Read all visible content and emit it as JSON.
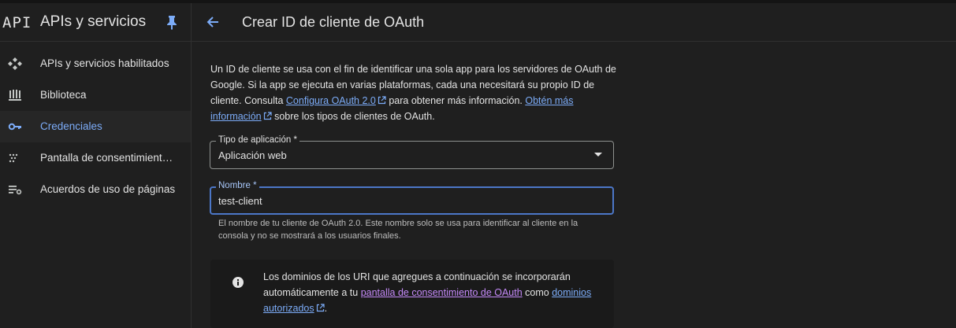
{
  "sidebar": {
    "logo": "API",
    "title": "APIs y servicios",
    "items": [
      {
        "label": "APIs y servicios habilitados",
        "icon": "api-services-icon"
      },
      {
        "label": "Biblioteca",
        "icon": "library-icon"
      },
      {
        "label": "Credenciales",
        "icon": "key-icon",
        "active": true
      },
      {
        "label": "Pantalla de consentimiento de OAuth",
        "icon": "consent-icon"
      },
      {
        "label": "Acuerdos de uso de páginas",
        "icon": "settings-list-icon"
      }
    ]
  },
  "header": {
    "title": "Crear ID de cliente de OAuth"
  },
  "description": {
    "text1": "Un ID de cliente se usa con el fin de identificar una sola app para los servidores de OAuth de Google. Si la app se ejecuta en varias plataformas, cada una necesitará su propio ID de cliente. Consulta ",
    "link1": "Configura OAuth 2.0",
    "text2": " para obtener más información. ",
    "link2": "Obtén más información",
    "text3": " sobre los tipos de clientes de OAuth."
  },
  "form": {
    "app_type": {
      "label": "Tipo de aplicación *",
      "value": "Aplicación web"
    },
    "name": {
      "label": "Nombre *",
      "value": "test-client",
      "hint": "El nombre de tu cliente de OAuth 2.0. Este nombre solo se usa para identificar al cliente en la consola y no se mostrará a los usuarios finales."
    }
  },
  "info": {
    "text1": "Los dominios de los URI que agregues a continuación se incorporarán automáticamente a tu ",
    "link1": "pantalla de consentimiento de OAuth",
    "text2": " como ",
    "link2": "dominios autorizados",
    "text3": "."
  },
  "colors": {
    "accent": "#7cacf8",
    "visited_link": "#c58af9",
    "focus_border": "#4c77c8",
    "background": "#1f1f1f"
  }
}
